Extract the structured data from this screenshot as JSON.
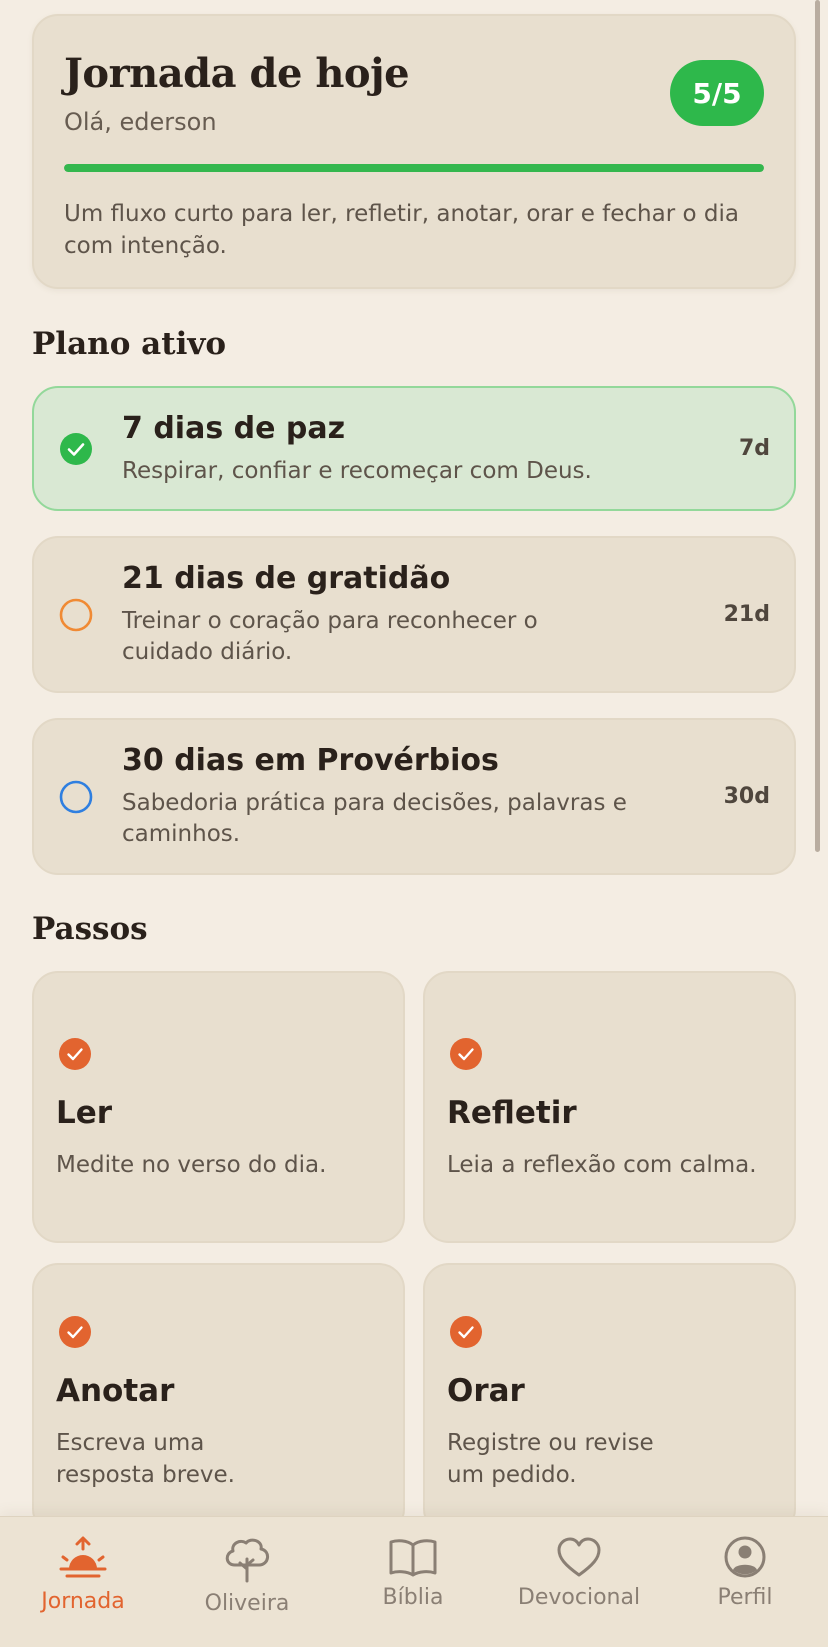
{
  "hero": {
    "title": "Jornada de hoje",
    "greeting": "Olá, ederson",
    "badge": "5/5",
    "progress_fraction": 1.0,
    "description": "Um fluxo curto para ler, refletir, anotar, orar e fechar o dia com intenção."
  },
  "plans_section": {
    "title": "Plano ativo",
    "plans": [
      {
        "title": "7 dias de paz",
        "subtitle": "Respirar, confiar e recomeçar com Deus.",
        "days": "7d",
        "status": "active",
        "icon": "check-circle-icon",
        "color": "#2eb84b"
      },
      {
        "title": "21 dias de gratidão",
        "subtitle": "Treinar o coração para reconhecer o cuidado diário.",
        "days": "21d",
        "status": "inactive",
        "icon": "circle-icon",
        "color": "#f08a34"
      },
      {
        "title": "30 dias em Provérbios",
        "subtitle": "Sabedoria prática para decisões, palavras e caminhos.",
        "days": "30d",
        "status": "inactive",
        "icon": "circle-icon",
        "color": "#2f7fe0"
      }
    ]
  },
  "steps_section": {
    "title": "Passos",
    "steps": [
      {
        "title": "Ler",
        "description": "Medite no verso do dia.",
        "done": true
      },
      {
        "title": "Refletir",
        "description": "Leia a reflexão com calma.",
        "done": true
      },
      {
        "title": "Anotar",
        "description": "Escreva uma resposta breve.",
        "done": true
      },
      {
        "title": "Orar",
        "description": "Registre ou revise um pedido.",
        "done": true
      }
    ]
  },
  "tabbar": {
    "tabs": [
      {
        "label": "Jornada",
        "icon": "sunrise-icon",
        "active": true
      },
      {
        "label": "Oliveira",
        "icon": "tree-icon",
        "active": false
      },
      {
        "label": "Bíblia",
        "icon": "book-icon",
        "active": false
      },
      {
        "label": "Devocional",
        "icon": "heart-icon",
        "active": false
      },
      {
        "label": "Perfil",
        "icon": "profile-icon",
        "active": false
      }
    ]
  },
  "colors": {
    "accent": "#e2642f",
    "success": "#2eb84b",
    "background": "#f4ede3",
    "card": "#e8dfcf"
  }
}
